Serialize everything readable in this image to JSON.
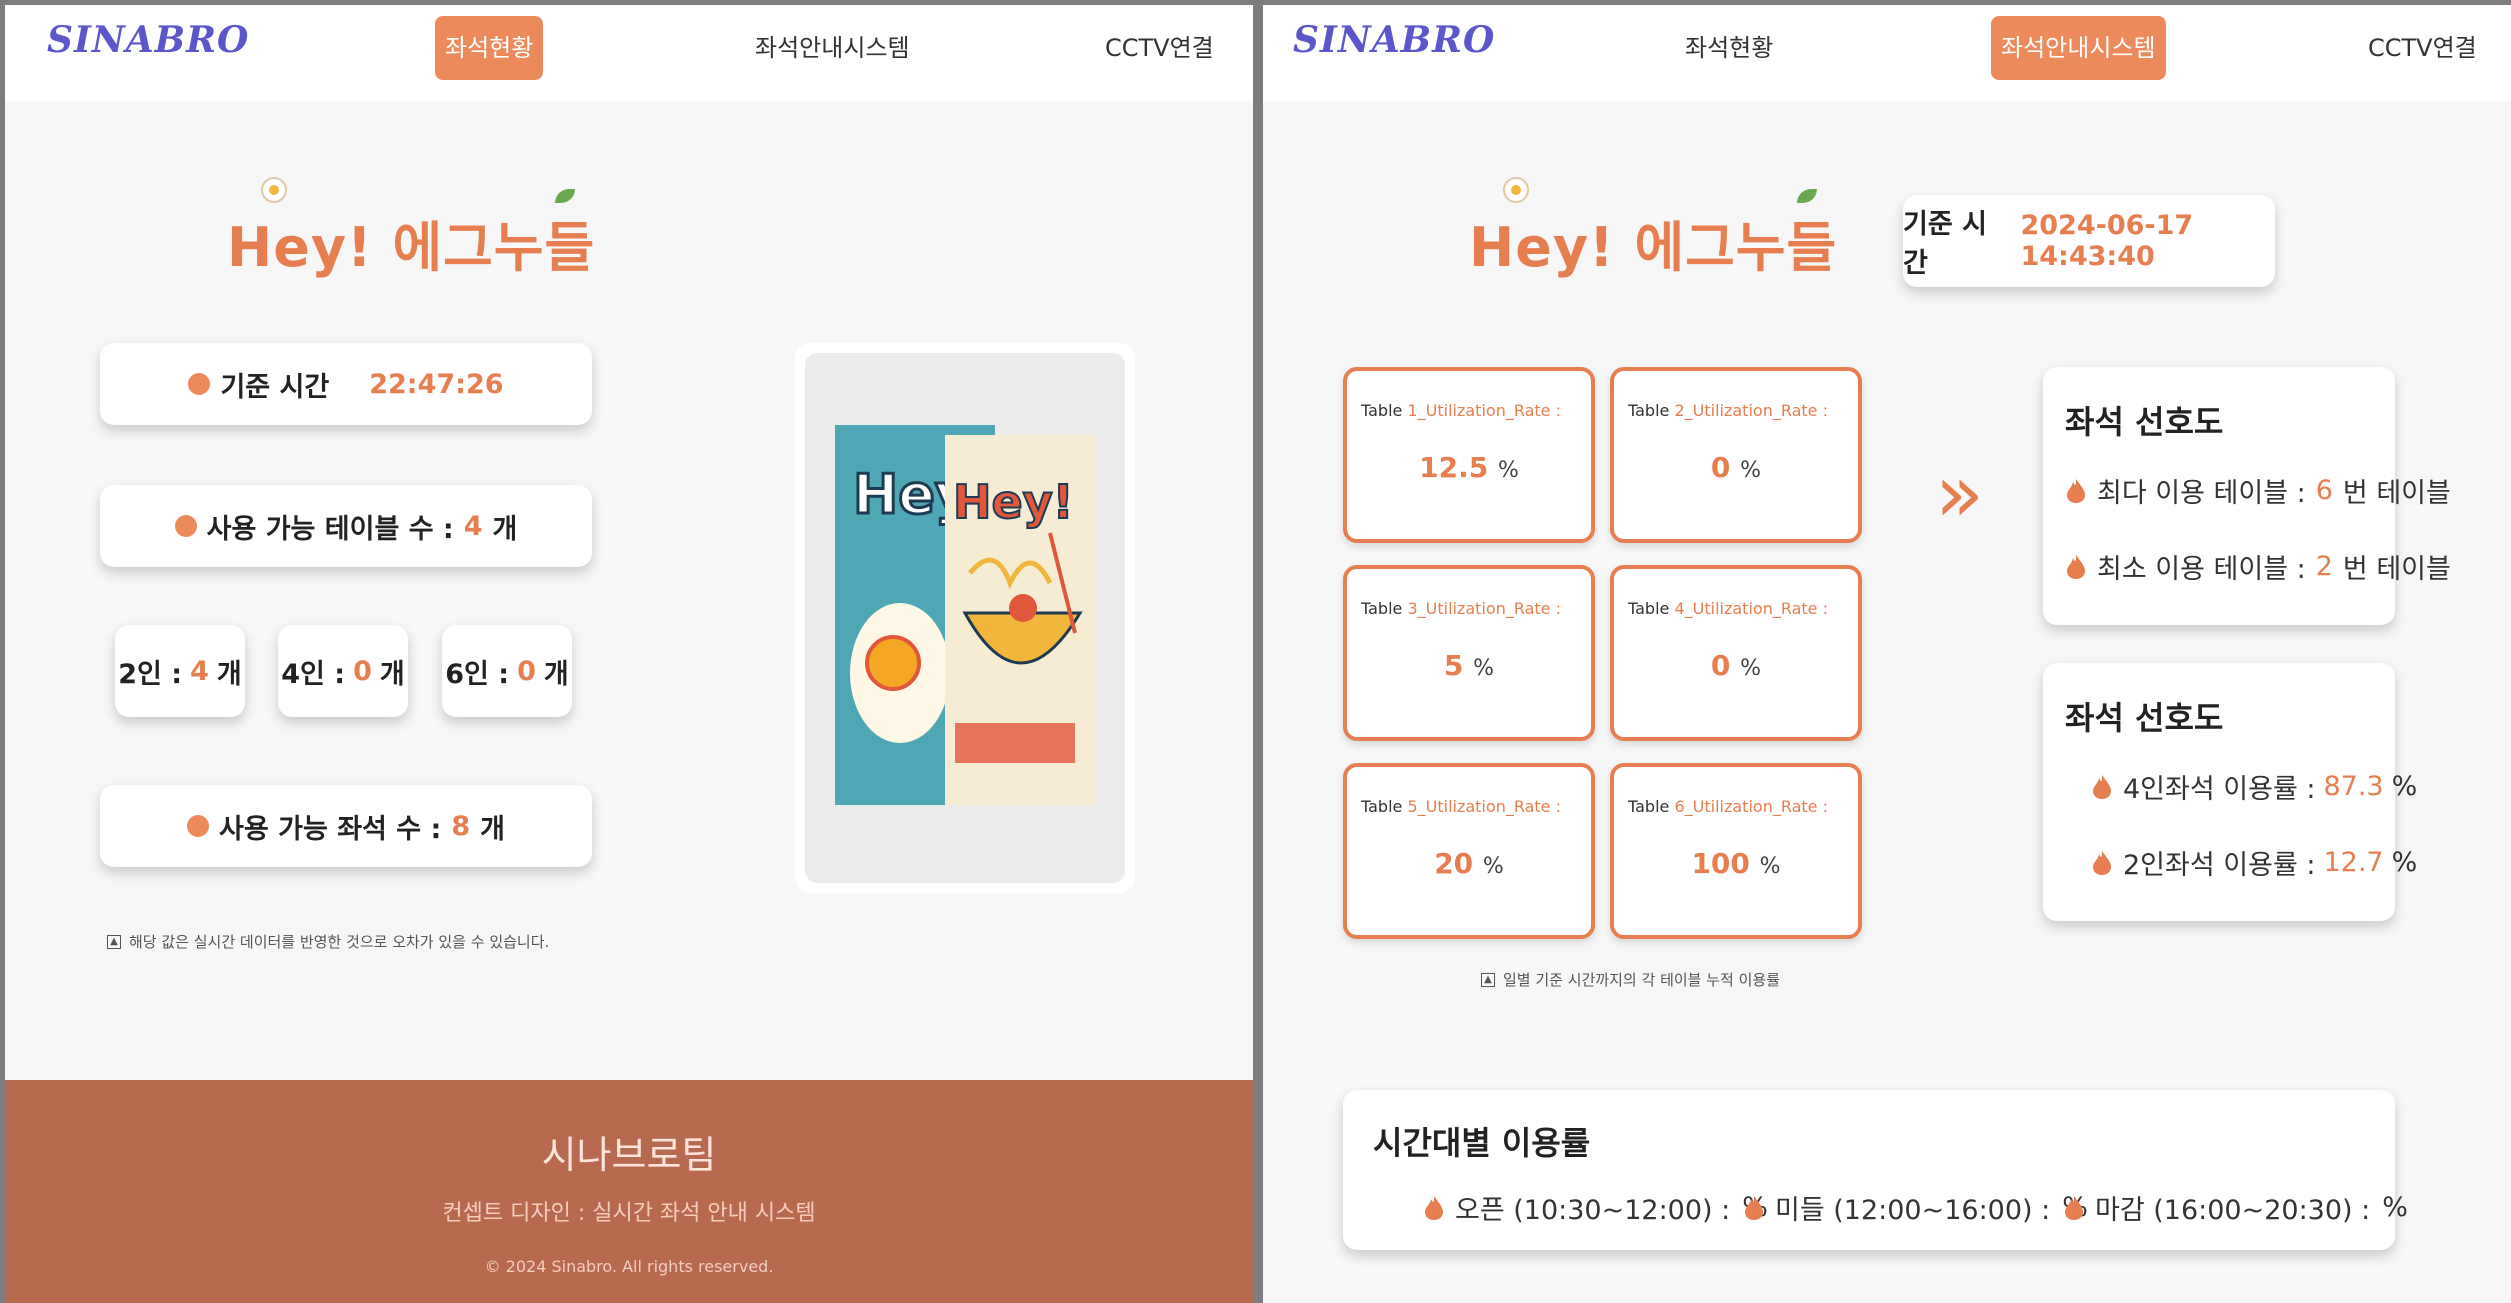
{
  "logo": "SINABRO",
  "brand": "Hey! 에그누들",
  "nav": {
    "seat_status": "좌석현황",
    "guide_system": "좌석안내시스템",
    "cctv": "CCTV연결"
  },
  "left": {
    "time_label": "기준 시간",
    "time_value": "22:47:26",
    "tables_label": "사용 가능 테이블 수 :",
    "tables_value": "4",
    "unit": "개",
    "sizes": [
      {
        "label": "2인 :",
        "value": "4",
        "unit": "개"
      },
      {
        "label": "4인 :",
        "value": "0",
        "unit": "개"
      },
      {
        "label": "6인 :",
        "value": "0",
        "unit": "개"
      }
    ],
    "seats_label": "사용 가능 좌석 수 :",
    "seats_value": "8",
    "note": "해당 값은 실시간 데이터를 반영한 것으로 오차가 있을 수 있습니다.",
    "poster_text_back": "Hey",
    "poster_text_front": "Hey!"
  },
  "footer": {
    "team": "시나브로팀",
    "concept": "컨셉트 디자인 : 실시간 좌석 안내 시스템",
    "copyright": "© 2024 Sinabro. All rights reserved."
  },
  "right": {
    "time_label": "기준 시간",
    "time_value": "2024-06-17 14:43:40",
    "tables": [
      {
        "prefix": "Table ",
        "num": "1",
        "suffix": "_Utilization_Rate :",
        "value": "12.5",
        "unit": "%"
      },
      {
        "prefix": "Table ",
        "num": "2",
        "suffix": "_Utilization_Rate :",
        "value": "0",
        "unit": "%"
      },
      {
        "prefix": "Table ",
        "num": "3",
        "suffix": "_Utilization_Rate :",
        "value": "5",
        "unit": "%"
      },
      {
        "prefix": "Table ",
        "num": "4",
        "suffix": "_Utilization_Rate :",
        "value": "0",
        "unit": "%"
      },
      {
        "prefix": "Table ",
        "num": "5",
        "suffix": "_Utilization_Rate :",
        "value": "20",
        "unit": "%"
      },
      {
        "prefix": "Table ",
        "num": "6",
        "suffix": "_Utilization_Rate :",
        "value": "100",
        "unit": "%"
      }
    ],
    "arrow": "»",
    "note": "일별 기준 시간까지의 각 테이블 누적 이용률",
    "pref1": {
      "title": "좌석 선호도",
      "max_label": "최다 이용 테이블 :",
      "max_value": "6",
      "max_unit": "번 테이블",
      "min_label": "최소 이용 테이블 :",
      "min_value": "2",
      "min_unit": "번 테이블"
    },
    "pref2": {
      "title": "좌석 선호도",
      "four_label": "4인좌석 이용률 :",
      "four_value": "87.3",
      "two_label": "2인좌석 이용률 :",
      "two_value": "12.7",
      "unit": "%"
    },
    "time_usage": {
      "title": "시간대별 이용률",
      "items": [
        {
          "label": "오픈 (10:30~12:00) :",
          "unit": "%"
        },
        {
          "label": "미들 (12:00~16:00) :",
          "unit": "%"
        },
        {
          "label": "마감 (16:00~20:30) :",
          "unit": "%"
        }
      ]
    }
  },
  "colors": {
    "accent": "#e67e4f",
    "nav_active": "#ec8a5c",
    "footer": "#b86a50",
    "logo": "#5b56c9"
  }
}
